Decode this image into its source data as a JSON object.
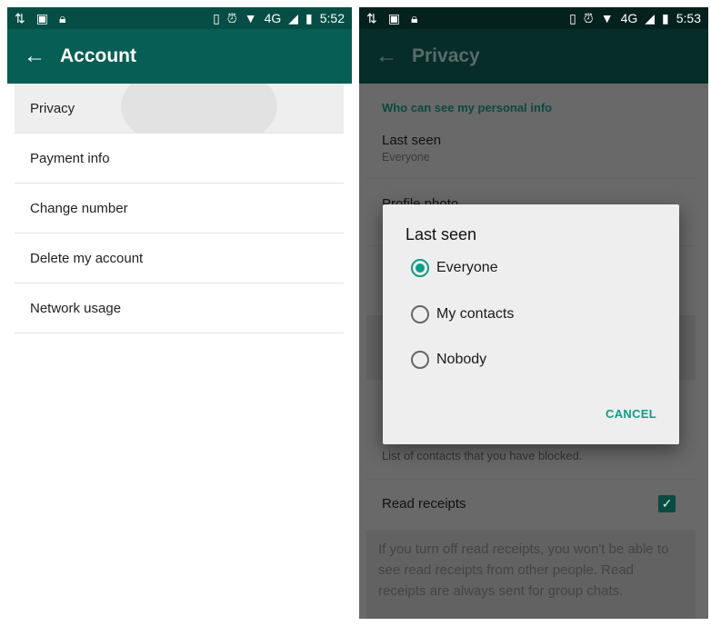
{
  "left": {
    "status": {
      "time": "5:52",
      "network": "4G"
    },
    "toolbar": {
      "title": "Account",
      "back_icon": "arrow-left-icon"
    },
    "items": [
      {
        "label": "Privacy"
      },
      {
        "label": "Payment info"
      },
      {
        "label": "Change number"
      },
      {
        "label": "Delete my account"
      },
      {
        "label": "Network usage"
      }
    ],
    "colors": {
      "statusbar": "#064e45",
      "toolbar": "#075e54"
    }
  },
  "right": {
    "status": {
      "time": "5:53",
      "network": "4G"
    },
    "toolbar": {
      "title": "Privacy",
      "back_icon": "arrow-left-icon"
    },
    "section_header": "Who can see my personal info",
    "last_seen": {
      "label": "Last seen",
      "value": "Everyone"
    },
    "profile_photo_partial": "Profile photo",
    "blocked_sub": "List of contacts that you have blocked.",
    "read_receipts": {
      "label": "Read receipts",
      "checked": true
    },
    "read_receipts_info": "If you turn off read receipts, you won't be able to see read receipts from other people. Read receipts are always sent for group chats.",
    "dialog": {
      "title": "Last seen",
      "options": [
        {
          "label": "Everyone",
          "selected": true
        },
        {
          "label": "My contacts",
          "selected": false
        },
        {
          "label": "Nobody",
          "selected": false
        }
      ],
      "cancel": "CANCEL"
    },
    "colors": {
      "accent": "#0f9d88",
      "statusbar": "#04211e",
      "toolbar": "#062d28"
    }
  }
}
